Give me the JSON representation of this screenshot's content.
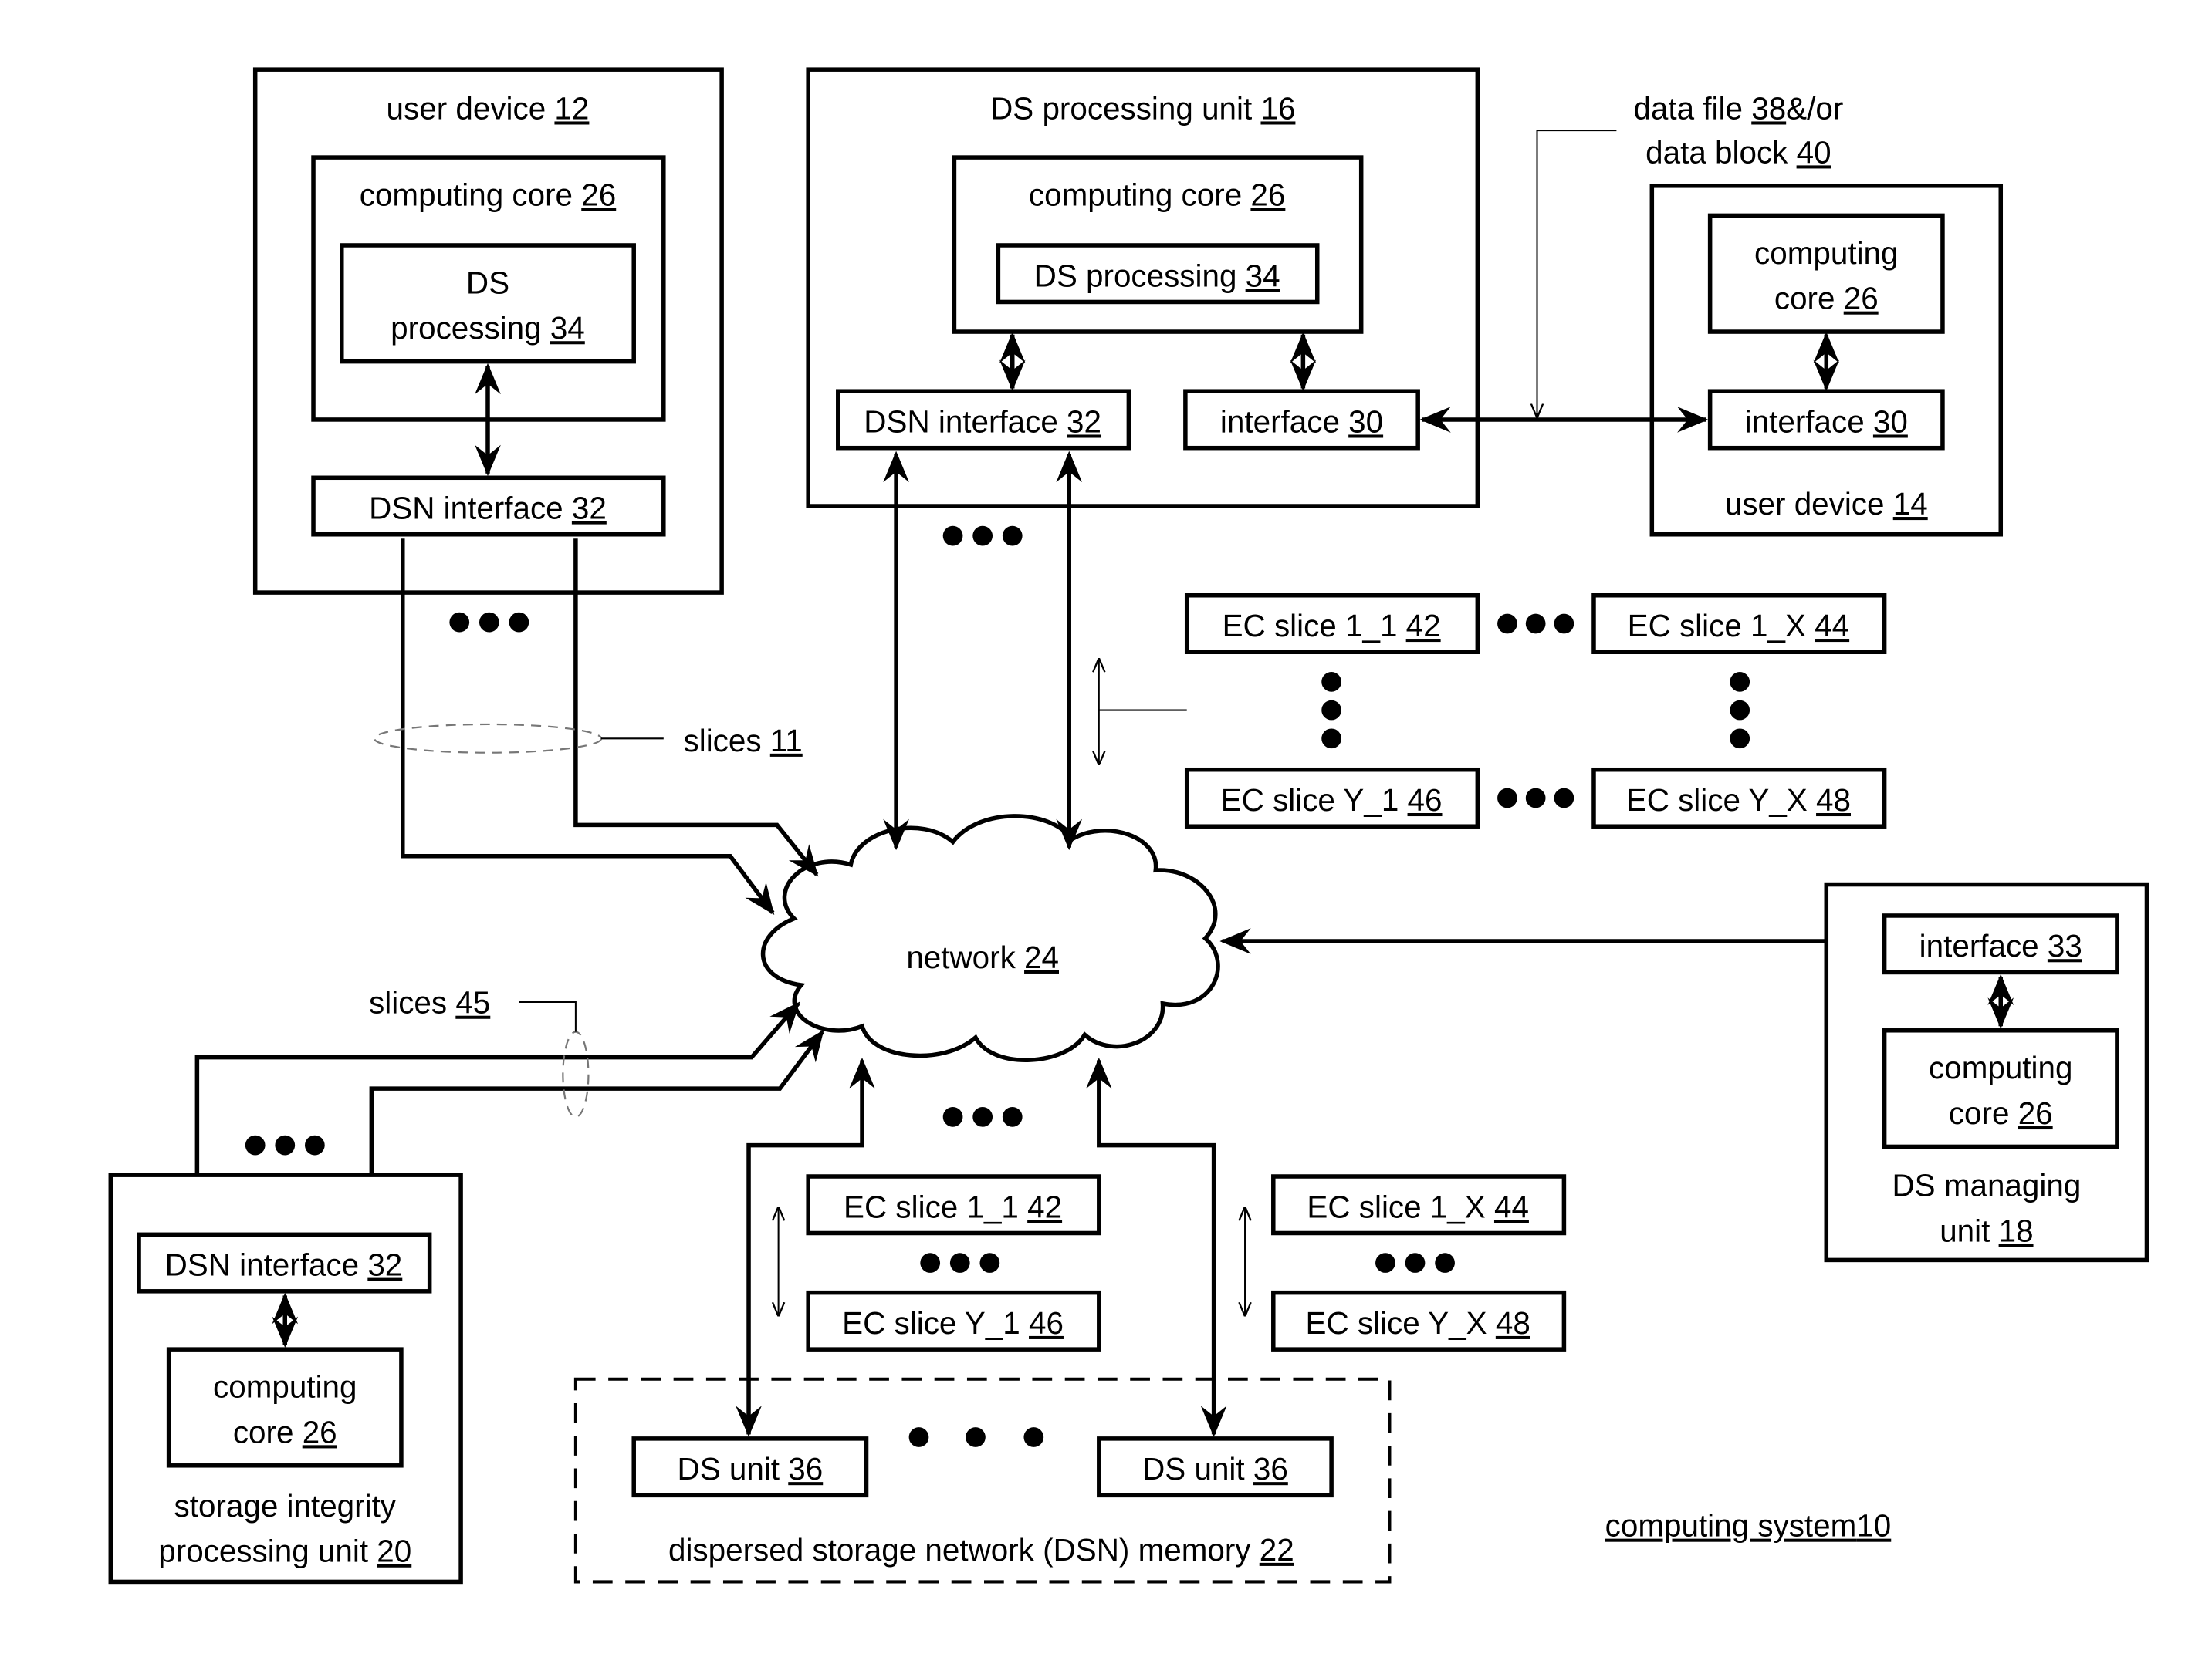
{
  "figure": {
    "title": {
      "text": "computing system",
      "ref": "10"
    },
    "colors": {
      "ink": "#000000",
      "background": "#ffffff"
    }
  },
  "components": {
    "user_device_12": {
      "label": {
        "text": "user device",
        "ref": "12"
      },
      "core": {
        "text": "computing core",
        "ref": "26"
      },
      "ds_processing": {
        "line1": "DS",
        "line2": "processing",
        "ref": "34"
      },
      "dsn_interface": {
        "text": "DSN interface",
        "ref": "32"
      }
    },
    "ds_processing_unit_16": {
      "label": {
        "text": "DS processing unit",
        "ref": "16"
      },
      "core": {
        "text": "computing core",
        "ref": "26"
      },
      "ds_processing": {
        "text": "DS processing",
        "ref": "34"
      },
      "dsn_interface": {
        "text": "DSN interface",
        "ref": "32"
      },
      "interface": {
        "text": "interface",
        "ref": "30"
      }
    },
    "user_device_14": {
      "label": {
        "text": "user device",
        "ref": "14"
      },
      "core": {
        "line1": "computing",
        "line2": "core",
        "ref": "26"
      },
      "interface": {
        "text": "interface",
        "ref": "30"
      }
    },
    "data_file_label": {
      "line1": "data file",
      "ref1": "38",
      "line1_suffix": "&/or",
      "line2": "data block",
      "ref2": "40"
    },
    "ec_slice_grid": [
      {
        "text": "EC slice 1_1",
        "ref": "42"
      },
      {
        "text": "EC slice 1_X",
        "ref": "44"
      },
      {
        "text": "EC slice Y_1",
        "ref": "46"
      },
      {
        "text": "EC slice Y_X",
        "ref": "48"
      }
    ],
    "slices_11": {
      "text": "slices",
      "ref": "11"
    },
    "slices_45": {
      "text": "slices",
      "ref": "45"
    },
    "network": {
      "text": "network",
      "ref": "24"
    },
    "ds_managing_unit_18": {
      "label": {
        "line1": "DS managing",
        "line2": "unit",
        "ref": "18"
      },
      "interface": {
        "text": "interface",
        "ref": "33"
      },
      "core": {
        "line1": "computing",
        "line2": "core",
        "ref": "26"
      }
    },
    "storage_integrity_unit_20": {
      "label": {
        "line1": "storage integrity",
        "line2": "processing unit",
        "ref": "20"
      },
      "dsn_interface": {
        "text": "DSN interface",
        "ref": "32"
      },
      "core": {
        "line1": "computing",
        "line2": "core",
        "ref": "26"
      }
    },
    "dsn_memory_22": {
      "label": {
        "text": "dispersed storage network (DSN) memory",
        "ref": "22"
      },
      "ds_units": [
        {
          "text": "DS unit",
          "ref": "36"
        },
        {
          "text": "DS unit",
          "ref": "36"
        }
      ],
      "left_slices": [
        {
          "text": "EC slice 1_1",
          "ref": "42"
        },
        {
          "text": "EC slice Y_1",
          "ref": "46"
        }
      ],
      "right_slices": [
        {
          "text": "EC slice 1_X",
          "ref": "44"
        },
        {
          "text": "EC slice Y_X",
          "ref": "48"
        }
      ]
    }
  }
}
